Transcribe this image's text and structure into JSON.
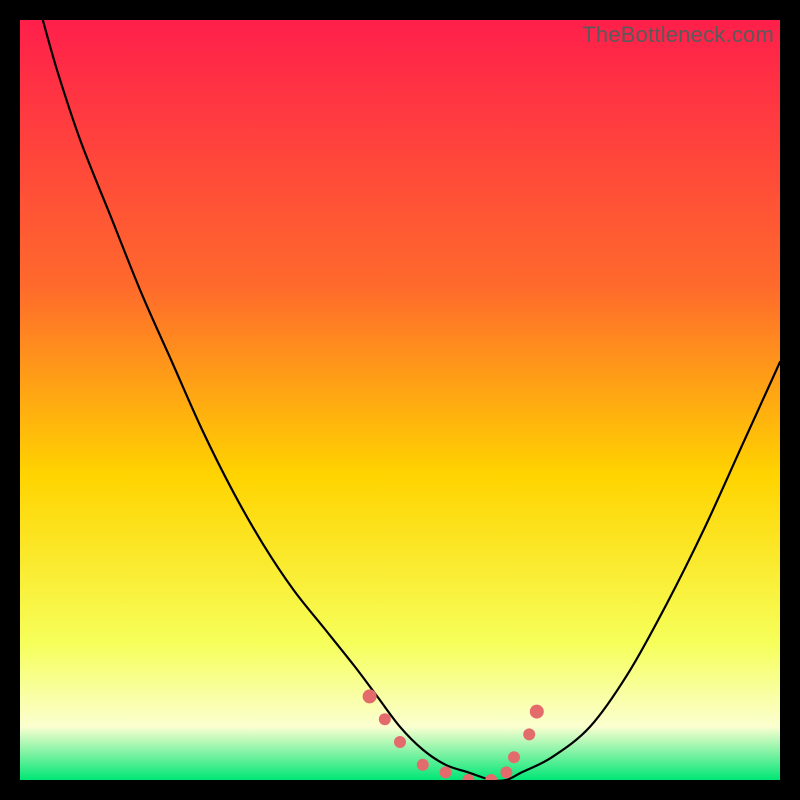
{
  "watermark": {
    "text": "TheBottleneck.com"
  },
  "colors": {
    "gradient_top": "#ff1f4b",
    "gradient_upper_mid": "#ff6a2c",
    "gradient_mid": "#ffd400",
    "gradient_lower_mid": "#f6ff5a",
    "gradient_pale": "#fbffd0",
    "gradient_bottom": "#00e676",
    "curve_stroke": "#000000",
    "marker_fill": "#e46b6b",
    "marker_stroke": "#c84f4f"
  },
  "chart_data": {
    "type": "line",
    "title": "",
    "xlabel": "",
    "ylabel": "",
    "xlim": [
      0,
      100
    ],
    "ylim": [
      0,
      100
    ],
    "grid": false,
    "legend": null,
    "series": [
      {
        "name": "bottleneck-curve",
        "x": [
          3,
          5,
          8,
          12,
          16,
          20,
          24,
          28,
          32,
          36,
          40,
          44,
          47,
          50,
          53,
          56,
          59,
          62,
          64,
          66,
          70,
          75,
          80,
          85,
          90,
          95,
          100
        ],
        "y": [
          100,
          93,
          84,
          74,
          64,
          55,
          46,
          38,
          31,
          25,
          20,
          15,
          11,
          7,
          4,
          2,
          1,
          0,
          0,
          1,
          3,
          7,
          14,
          23,
          33,
          44,
          55
        ]
      }
    ],
    "annotations": [],
    "markers": {
      "name": "highlight-points",
      "x": [
        46,
        48,
        50,
        53,
        56,
        59,
        62,
        64,
        65,
        67,
        68
      ],
      "y": [
        11,
        8,
        5,
        2,
        1,
        0,
        0,
        1,
        3,
        6,
        9
      ]
    }
  }
}
